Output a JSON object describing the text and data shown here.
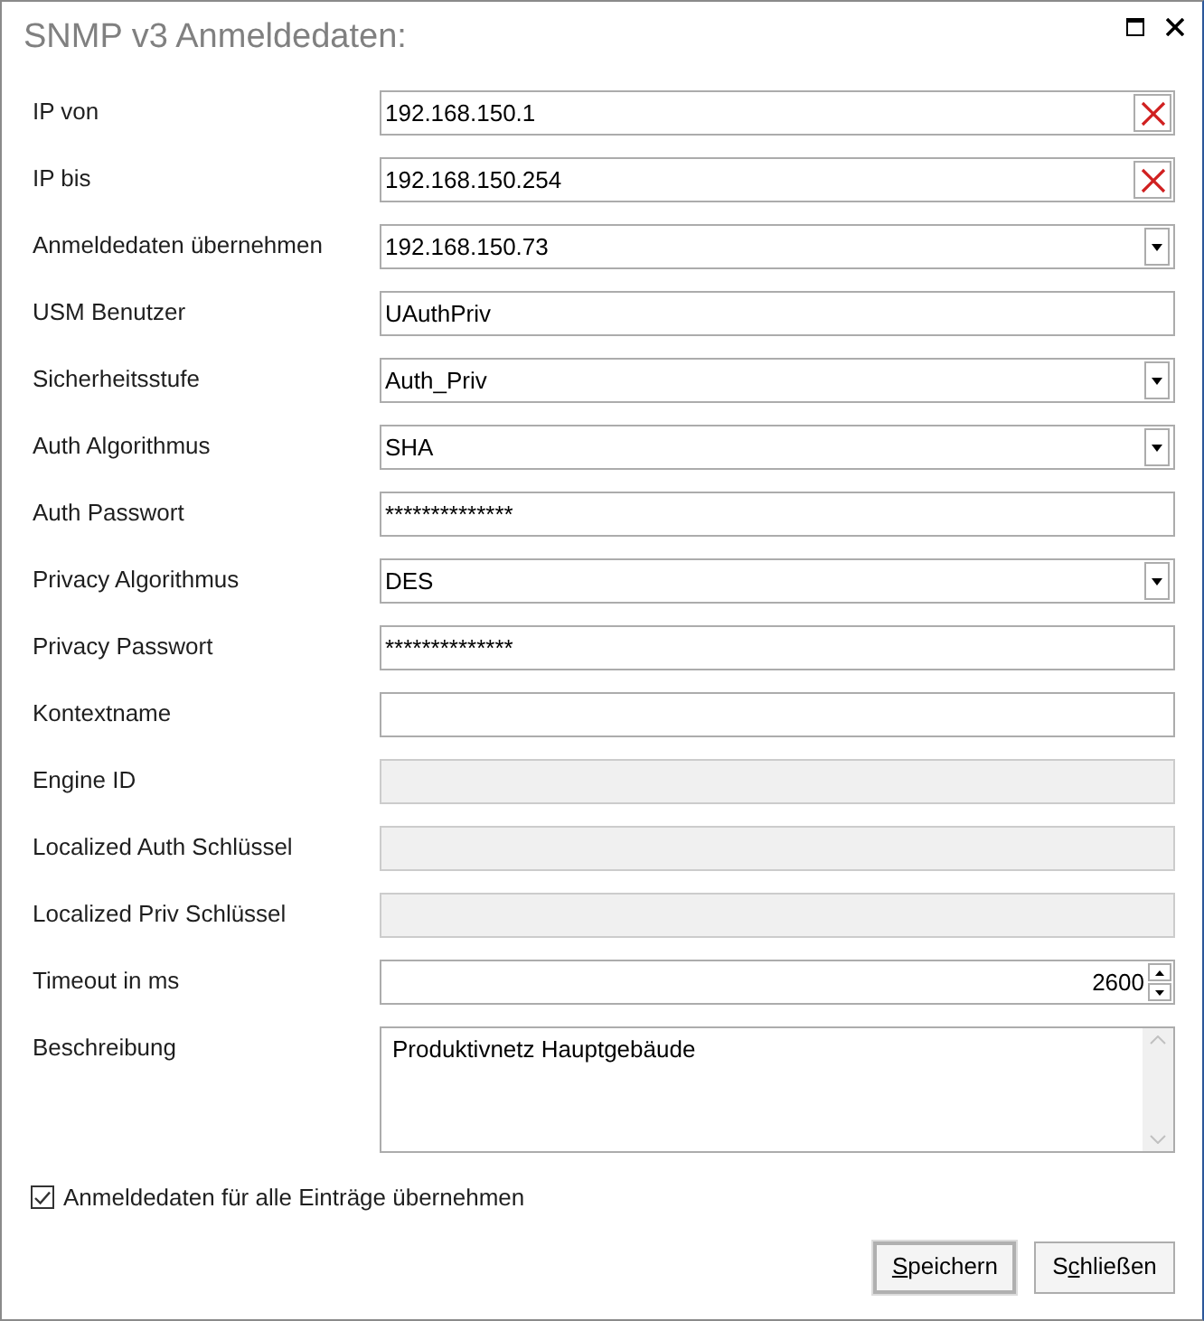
{
  "window": {
    "title": "SNMP v3 Anmeldedaten:"
  },
  "fields": [
    {
      "label": "IP von",
      "kind": "clearable",
      "value": "192.168.150.1",
      "disabled": false
    },
    {
      "label": "IP bis",
      "kind": "clearable",
      "value": "192.168.150.254",
      "disabled": false
    },
    {
      "label": "Anmeldedaten übernehmen",
      "kind": "combo",
      "value": "192.168.150.73",
      "disabled": false
    },
    {
      "label": "USM Benutzer",
      "kind": "text",
      "value": "UAuthPriv",
      "disabled": false
    },
    {
      "label": "Sicherheitsstufe",
      "kind": "combo",
      "value": "Auth_Priv",
      "disabled": false
    },
    {
      "label": "Auth Algorithmus",
      "kind": "combo",
      "value": "SHA",
      "disabled": false
    },
    {
      "label": "Auth Passwort",
      "kind": "text",
      "value": "**************",
      "disabled": false
    },
    {
      "label": "Privacy Algorithmus",
      "kind": "combo",
      "value": "DES",
      "disabled": false
    },
    {
      "label": "Privacy Passwort",
      "kind": "text",
      "value": "**************",
      "disabled": false
    },
    {
      "label": "Kontextname",
      "kind": "text",
      "disabled": false
    },
    {
      "label": "Engine ID",
      "kind": "text",
      "disabled": true
    },
    {
      "label": "Localized Auth Schlüssel",
      "kind": "text",
      "disabled": true
    },
    {
      "label": "Localized Priv Schlüssel",
      "kind": "text",
      "disabled": true
    },
    {
      "label": "Timeout in ms",
      "kind": "spinner",
      "value": "2600",
      "disabled": false
    },
    {
      "label": "Beschreibung",
      "kind": "multiline",
      "value": "Produktivnetz Hauptgebäude",
      "disabled": false
    }
  ],
  "apply_all": {
    "label": "Anmeldedaten für alle Einträge übernehmen",
    "checked": true
  },
  "buttons": [
    {
      "label_parts": [
        {
          "text": "S",
          "underlined": true
        },
        {
          "text": "peichern",
          "underlined": false
        }
      ],
      "default": true
    },
    {
      "label_parts": [
        {
          "text": "S",
          "underlined": false
        },
        {
          "text": "c",
          "underlined": true
        },
        {
          "text": "hließen",
          "underlined": false
        }
      ],
      "default": false
    }
  ]
}
